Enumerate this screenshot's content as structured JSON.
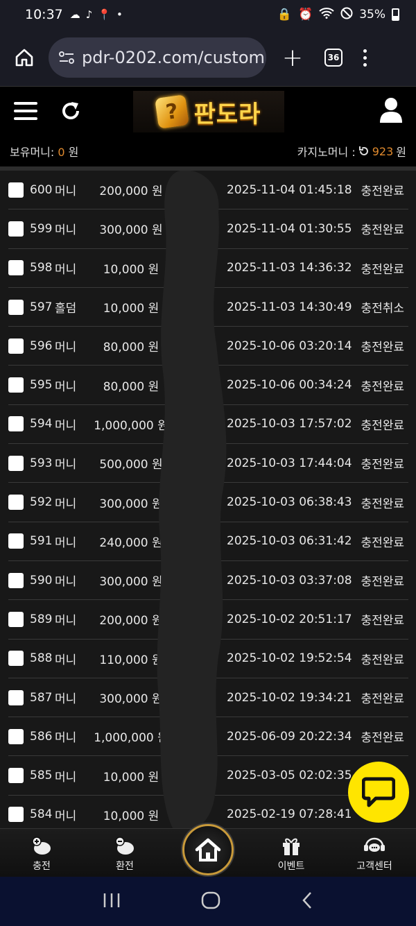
{
  "status_bar": {
    "time": "10:37",
    "battery": "35%"
  },
  "browser": {
    "url": "pdr-0202.com/custom",
    "tab_count": "36",
    "new_tab_label": "+"
  },
  "header": {
    "logo_mark": "?",
    "logo_text": "판도라"
  },
  "balance": {
    "holding_label": "보유머니: ",
    "holding_value": "0",
    "unit": " 원",
    "casino_label": "카지노머니 : ",
    "casino_value": "923",
    "casino_unit": " 원"
  },
  "rows": [
    {
      "id": "600",
      "type": "머니",
      "amount": "200,000 원",
      "date": "2025-11-04 01:45:18",
      "status": "충전완료"
    },
    {
      "id": "599",
      "type": "머니",
      "amount": "300,000 원",
      "date": "2025-11-04 01:30:55",
      "status": "충전완료"
    },
    {
      "id": "598",
      "type": "머니",
      "amount": "10,000 원",
      "date": "2025-11-03 14:36:32",
      "status": "충전완료"
    },
    {
      "id": "597",
      "type": "홀덤",
      "amount": "10,000 원",
      "date": "2025-11-03 14:30:49",
      "status": "충전취소"
    },
    {
      "id": "596",
      "type": "머니",
      "amount": "80,000 원",
      "date": "2025-10-06 03:20:14",
      "status": "충전완료"
    },
    {
      "id": "595",
      "type": "머니",
      "amount": "80,000 원",
      "date": "2025-10-06 00:34:24",
      "status": "충전완료"
    },
    {
      "id": "594",
      "type": "머니",
      "amount": "1,000,000 원",
      "date": "2025-10-03 17:57:02",
      "status": "충전완료"
    },
    {
      "id": "593",
      "type": "머니",
      "amount": "500,000 원",
      "date": "2025-10-03 17:44:04",
      "status": "충전완료"
    },
    {
      "id": "592",
      "type": "머니",
      "amount": "300,000 원",
      "date": "2025-10-03 06:38:43",
      "status": "충전완료"
    },
    {
      "id": "591",
      "type": "머니",
      "amount": "240,000 원",
      "date": "2025-10-03 06:31:42",
      "status": "충전완료"
    },
    {
      "id": "590",
      "type": "머니",
      "amount": "300,000 원",
      "date": "2025-10-03 03:37:08",
      "status": "충전완료"
    },
    {
      "id": "589",
      "type": "머니",
      "amount": "200,000 원",
      "date": "2025-10-02 20:51:17",
      "status": "충전완료"
    },
    {
      "id": "588",
      "type": "머니",
      "amount": "110,000 원",
      "date": "2025-10-02 19:52:54",
      "status": "충전완료"
    },
    {
      "id": "587",
      "type": "머니",
      "amount": "300,000 원",
      "date": "2025-10-02 19:34:21",
      "status": "충전완료"
    },
    {
      "id": "586",
      "type": "머니",
      "amount": "1,000,000 원",
      "date": "2025-06-09 20:22:34",
      "status": "충전완료"
    },
    {
      "id": "585",
      "type": "머니",
      "amount": "10,000 원",
      "date": "2025-03-05 02:02:35",
      "status": ""
    },
    {
      "id": "584",
      "type": "머니",
      "amount": "10,000 원",
      "date": "2025-02-19 07:28:41",
      "status": ""
    }
  ],
  "nav": {
    "deposit": "충전",
    "withdraw": "환전",
    "event": "이벤트",
    "support": "고객센터"
  }
}
